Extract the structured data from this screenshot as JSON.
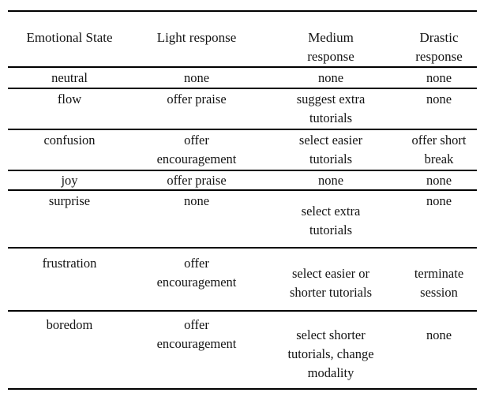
{
  "table": {
    "columns": [
      {
        "key": "emotional_state",
        "label": "Emotional State"
      },
      {
        "key": "light_response",
        "label": "Light response"
      },
      {
        "key": "medium_response",
        "label": "Medium\nresponse"
      },
      {
        "key": "drastic_response",
        "label": "Drastic\nresponse"
      }
    ],
    "rows": [
      {
        "emotional_state": "neutral",
        "light_response": "none",
        "medium_response": "none",
        "drastic_response": "none"
      },
      {
        "emotional_state": "flow",
        "light_response": "offer praise",
        "medium_response": "suggest extra\ntutorials",
        "drastic_response": "none"
      },
      {
        "emotional_state": "confusion",
        "light_response": "offer\nencouragement",
        "medium_response": "select easier\ntutorials",
        "drastic_response": "offer short\nbreak"
      },
      {
        "emotional_state": "joy",
        "light_response": "offer praise",
        "medium_response": "none",
        "drastic_response": "none"
      },
      {
        "emotional_state": "surprise",
        "light_response": "none",
        "medium_response": "select extra\ntutorials",
        "drastic_response": "none"
      },
      {
        "emotional_state": "frustration",
        "light_response": "offer\nencouragement",
        "medium_response": "select easier or\nshorter tutorials",
        "drastic_response": "terminate\nsession"
      },
      {
        "emotional_state": "boredom",
        "light_response": "offer\nencouragement",
        "medium_response": "select shorter\ntutorials, change\nmodality",
        "drastic_response": "none"
      }
    ]
  },
  "style": {
    "rule_color": "#000000",
    "text_color": "#141414",
    "background": "#ffffff"
  }
}
